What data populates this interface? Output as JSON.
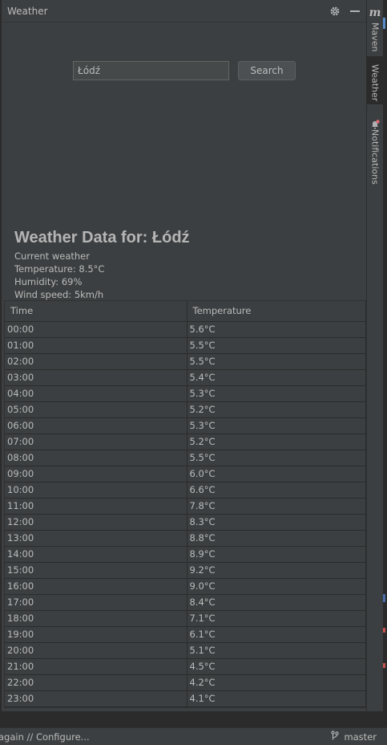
{
  "toolwindow": {
    "title": "Weather"
  },
  "search": {
    "value": "Łódź",
    "button_label": "Search"
  },
  "summary": {
    "heading": "Weather Data for: Łódź",
    "lines": [
      "Current weather",
      "Temperature: 8.5°C",
      "Humidity: 69%",
      "Wind speed: 5km/h"
    ]
  },
  "table": {
    "columns": [
      "Time",
      "Temperature"
    ],
    "rows": [
      [
        "00:00",
        "5.6°C"
      ],
      [
        "01:00",
        "5.5°C"
      ],
      [
        "02:00",
        "5.5°C"
      ],
      [
        "03:00",
        "5.4°C"
      ],
      [
        "04:00",
        "5.3°C"
      ],
      [
        "05:00",
        "5.2°C"
      ],
      [
        "06:00",
        "5.3°C"
      ],
      [
        "07:00",
        "5.2°C"
      ],
      [
        "08:00",
        "5.5°C"
      ],
      [
        "09:00",
        "6.0°C"
      ],
      [
        "10:00",
        "6.6°C"
      ],
      [
        "11:00",
        "7.8°C"
      ],
      [
        "12:00",
        "8.3°C"
      ],
      [
        "13:00",
        "8.8°C"
      ],
      [
        "14:00",
        "8.9°C"
      ],
      [
        "15:00",
        "9.2°C"
      ],
      [
        "16:00",
        "9.0°C"
      ],
      [
        "17:00",
        "8.4°C"
      ],
      [
        "18:00",
        "7.1°C"
      ],
      [
        "19:00",
        "6.1°C"
      ],
      [
        "20:00",
        "5.1°C"
      ],
      [
        "21:00",
        "4.5°C"
      ],
      [
        "22:00",
        "4.2°C"
      ],
      [
        "23:00",
        "4.1°C"
      ]
    ]
  },
  "sidebar": {
    "tabs": [
      {
        "label": "Maven",
        "icon": "maven-icon"
      },
      {
        "label": "Weather",
        "icon": ""
      },
      {
        "label": "Notifications",
        "icon": "bell-icon"
      }
    ]
  },
  "statusbar": {
    "text": "again // Configure...",
    "branch": "master"
  },
  "colors": {
    "bg": "#3c3f41",
    "editor": "#2b2b2b",
    "text": "#bbbbbb",
    "notification_dot": "#e06c75"
  }
}
